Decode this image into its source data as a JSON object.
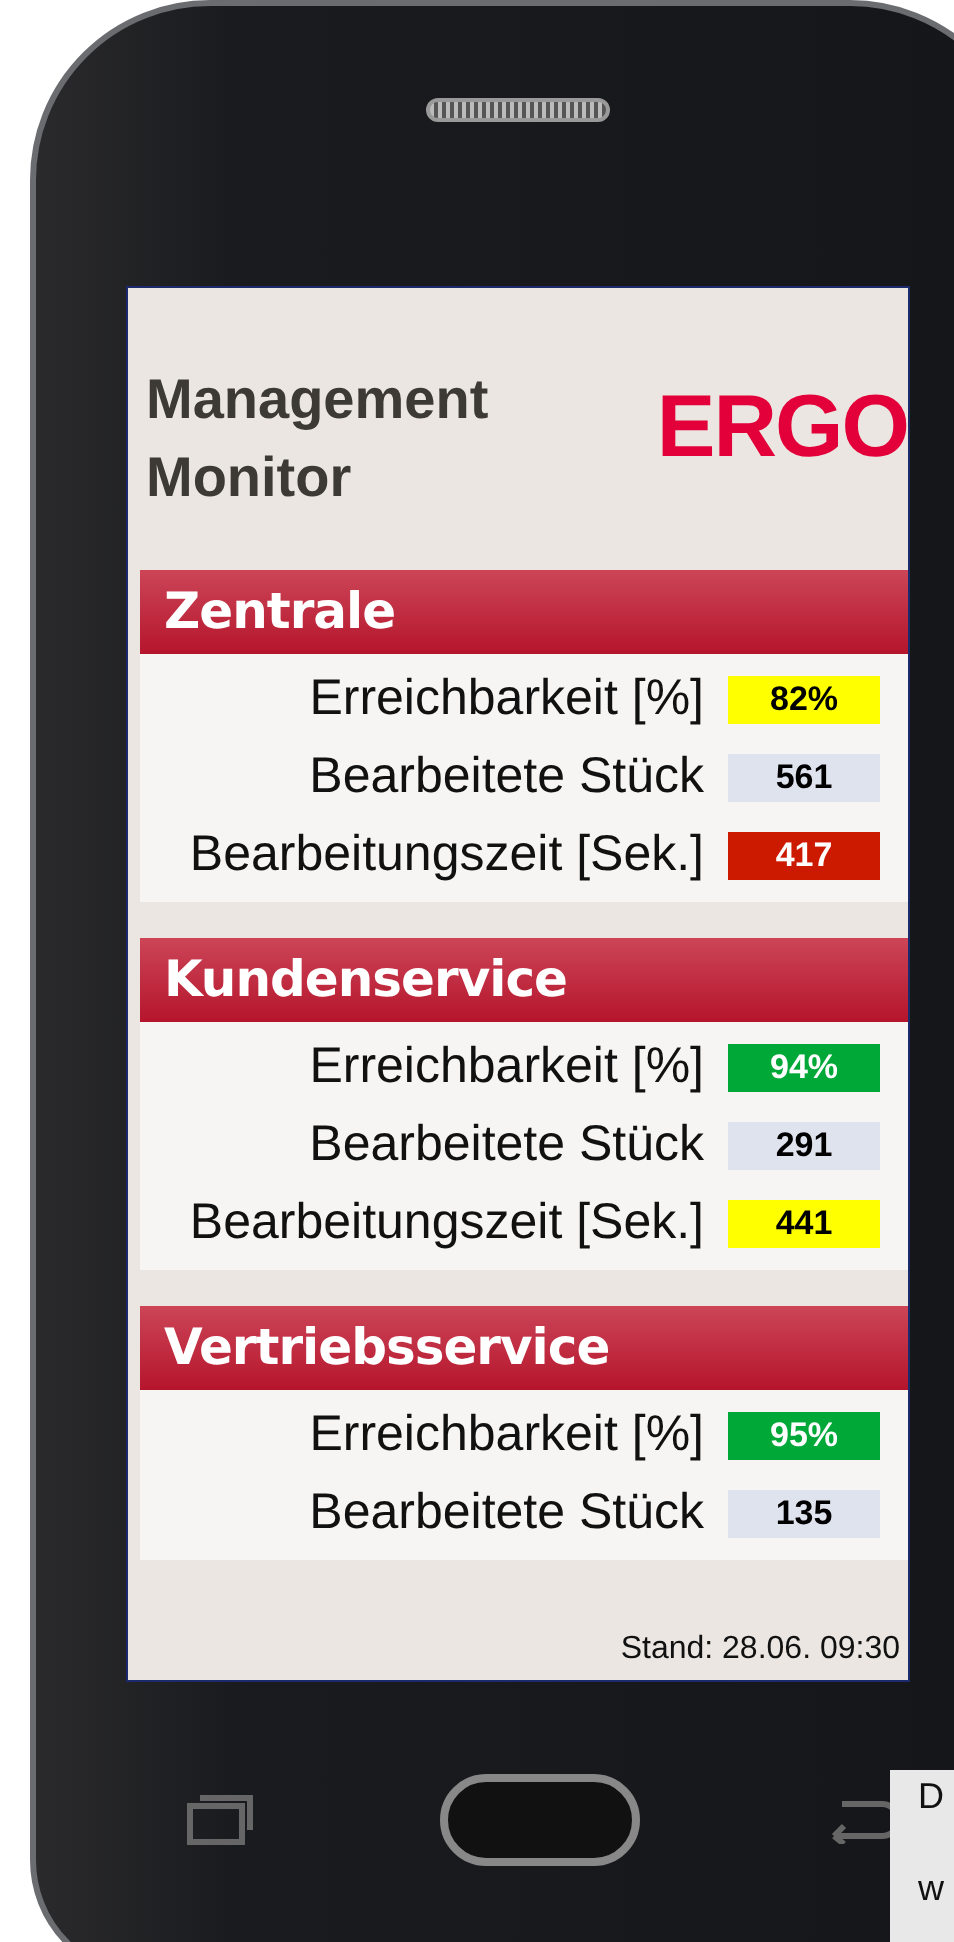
{
  "app": {
    "title": "Management Monitor",
    "logo": "ERGO"
  },
  "sections": [
    {
      "title": "Zentrale",
      "rows": [
        {
          "label": "Erreichbarkeit [%]",
          "value": "82%",
          "color": "#ffff00"
        },
        {
          "label": "Bearbeitete Stück",
          "value": "561",
          "color": "#dfe3ee"
        },
        {
          "label": "Bearbeitungszeit [Sek.]",
          "value": "417",
          "color": "#cc1a00"
        }
      ]
    },
    {
      "title": "Kundenservice",
      "rows": [
        {
          "label": "Erreichbarkeit [%]",
          "value": "94%",
          "color": "#00a838"
        },
        {
          "label": "Bearbeitete Stück",
          "value": "291",
          "color": "#dfe3ee"
        },
        {
          "label": "Bearbeitungszeit [Sek.]",
          "value": "441",
          "color": "#ffff00"
        }
      ]
    },
    {
      "title": "Vertriebsservice",
      "rows": [
        {
          "label": "Erreichbarkeit [%]",
          "value": "95%",
          "color": "#00a838"
        },
        {
          "label": "Bearbeitete Stück",
          "value": "135",
          "color": "#dfe3ee"
        }
      ]
    }
  ],
  "footer": "Stand: 28.06. 09:30",
  "background_note": [
    "D",
    "w"
  ]
}
